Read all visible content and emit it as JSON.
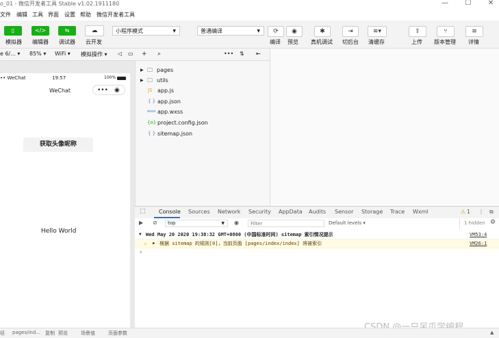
{
  "window": {
    "title": "o_01 - 微信开发者工具 Stable v1.02.1911180",
    "minimize": "—",
    "maximize": "☐",
    "close": "✕"
  },
  "menubar": {
    "items": [
      "文件",
      "编辑",
      "工具",
      "界面",
      "设置",
      "帮助",
      "微信开发者工具"
    ]
  },
  "toolbar": {
    "simulator_label": "模拟器",
    "editor_label": "编辑器",
    "debugger_label": "调试器",
    "cloud_label": "云开发",
    "mode_select": "小程序模式",
    "compile_select": "普通编译",
    "compile_label": "编译",
    "preview_label": "预览",
    "device_debug_label": "真机调试",
    "background_label": "切后台",
    "clear_cache_label": "清缓存",
    "upload_label": "上传",
    "version_label": "版本管理",
    "details_label": "详情",
    "accent_green": "#1aad19"
  },
  "simbar": {
    "device": "e 6/...",
    "zoom": "85%",
    "network": "WiFi",
    "simulate_ops": "模拟操作"
  },
  "phone": {
    "status_carrier": "•• WeChat",
    "status_time": "19:57",
    "status_battery": "100%",
    "nav_title": "WeChat",
    "button_label": "获取头像昵称",
    "hello_text": "Hello World"
  },
  "filetree": {
    "items": [
      {
        "icon": "folder",
        "name": "pages"
      },
      {
        "icon": "folder",
        "name": "utils"
      },
      {
        "icon": "JS",
        "name": "app.js"
      },
      {
        "icon": "{ }",
        "name": "app.json"
      },
      {
        "icon": "wxss",
        "name": "app.wxss"
      },
      {
        "icon": "{o}",
        "name": "project.config.json"
      },
      {
        "icon": "{ }",
        "name": "sitemap.json"
      }
    ]
  },
  "devtools": {
    "tabs": [
      "Console",
      "Sources",
      "Network",
      "Security",
      "AppData",
      "Audits",
      "Sensor",
      "Storage",
      "Trace",
      "Wxml"
    ],
    "active_tab": "Console",
    "warning_count": "1",
    "context": "top",
    "filter_placeholder": "Filter",
    "levels": "Default levels",
    "hidden": "1 hidden"
  },
  "console": {
    "group_header": "Wed May 20 2020 19:38:32 GMT+0800 (中国标准时间) sitemap 索引情况提示",
    "group_source": "VM53:4",
    "warning_text": "根据 sitemap 的规则[0]，当前页面 [pages/index/index] 将被索引",
    "warning_source": "VM26:1",
    "prompt": "›"
  },
  "statusbar": {
    "items": [
      "径",
      "pages/ind...",
      "复制",
      "预览",
      "场景值",
      "页面参数"
    ]
  },
  "watermark": "CSDN @一只呆瓜学编程"
}
